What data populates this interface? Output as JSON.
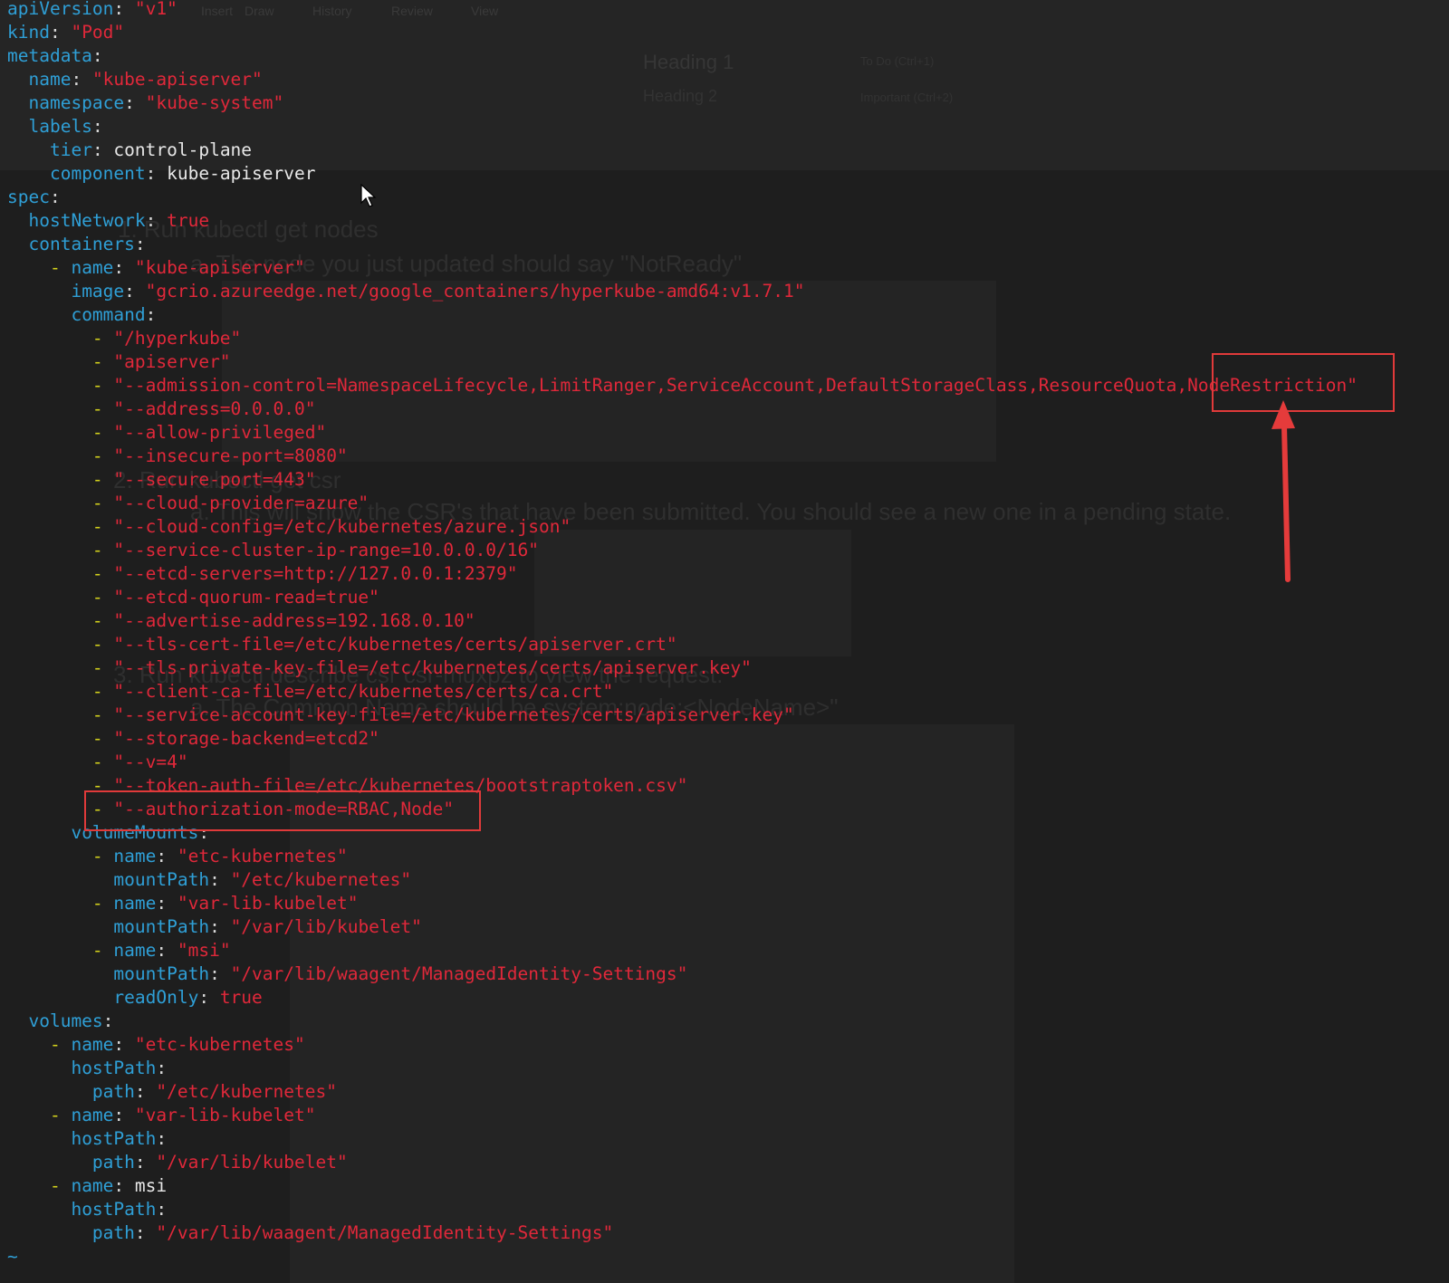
{
  "background_app": {
    "menu": [
      "Insert",
      "Draw",
      "History",
      "Review",
      "View"
    ],
    "heading1": "Heading 1",
    "heading2": "Heading 2",
    "todo_tag": "To Do (Ctrl+1)",
    "important_tag": "Important (Ctrl+2)",
    "notes": [
      "1.   Run kubectl get nodes",
      "a.  The node you just updated should say \"NotReady\"",
      "2.  Run kubectl get csr",
      "a.  This will show the CSR's that have been submitted. You should see a new one in a pending state.",
      "3.  Run kubectl describe csr csr-muxpz to view the request.",
      "a.  The Common Name should be system:node:<NodeName>\""
    ]
  },
  "terminal": {
    "lines": [
      [
        [
          "k",
          "apiVersion"
        ],
        [
          "p",
          ": "
        ],
        [
          "s",
          "\"v1\""
        ]
      ],
      [
        [
          "k",
          "kind"
        ],
        [
          "p",
          ": "
        ],
        [
          "s",
          "\"Pod\""
        ]
      ],
      [
        [
          "k",
          "metadata"
        ],
        [
          "p",
          ":"
        ]
      ],
      [
        [
          "p",
          "  "
        ],
        [
          "k",
          "name"
        ],
        [
          "p",
          ": "
        ],
        [
          "s",
          "\"kube-apiserver\""
        ]
      ],
      [
        [
          "p",
          "  "
        ],
        [
          "k",
          "namespace"
        ],
        [
          "p",
          ": "
        ],
        [
          "s",
          "\"kube-system\""
        ]
      ],
      [
        [
          "p",
          "  "
        ],
        [
          "k",
          "labels"
        ],
        [
          "p",
          ":"
        ]
      ],
      [
        [
          "p",
          "    "
        ],
        [
          "k",
          "tier"
        ],
        [
          "p",
          ": "
        ],
        [
          "v",
          "control-plane"
        ]
      ],
      [
        [
          "p",
          "    "
        ],
        [
          "k",
          "component"
        ],
        [
          "p",
          ": "
        ],
        [
          "v",
          "kube-apiserver"
        ]
      ],
      [
        [
          "k",
          "spec"
        ],
        [
          "p",
          ":"
        ]
      ],
      [
        [
          "p",
          "  "
        ],
        [
          "k",
          "hostNetwork"
        ],
        [
          "p",
          ": "
        ],
        [
          "s",
          "true"
        ]
      ],
      [
        [
          "p",
          "  "
        ],
        [
          "k",
          "containers"
        ],
        [
          "p",
          ":"
        ]
      ],
      [
        [
          "p",
          "    "
        ],
        [
          "d",
          "- "
        ],
        [
          "k",
          "name"
        ],
        [
          "p",
          ": "
        ],
        [
          "s",
          "\"kube-apiserver\""
        ]
      ],
      [
        [
          "p",
          "      "
        ],
        [
          "k",
          "image"
        ],
        [
          "p",
          ": "
        ],
        [
          "s",
          "\"gcrio.azureedge.net/google_containers/hyperkube-amd64:v1.7.1\""
        ]
      ],
      [
        [
          "p",
          "      "
        ],
        [
          "k",
          "command"
        ],
        [
          "p",
          ":"
        ]
      ],
      [
        [
          "p",
          "        "
        ],
        [
          "d",
          "- "
        ],
        [
          "s",
          "\"/hyperkube\""
        ]
      ],
      [
        [
          "p",
          "        "
        ],
        [
          "d",
          "- "
        ],
        [
          "s",
          "\"apiserver\""
        ]
      ],
      [
        [
          "p",
          "        "
        ],
        [
          "d",
          "- "
        ],
        [
          "s",
          "\"--admission-control=NamespaceLifecycle,LimitRanger,ServiceAccount,DefaultStorageClass,ResourceQuota,NodeRestriction\""
        ]
      ],
      [
        [
          "p",
          "        "
        ],
        [
          "d",
          "- "
        ],
        [
          "s",
          "\"--address=0.0.0.0\""
        ]
      ],
      [
        [
          "p",
          "        "
        ],
        [
          "d",
          "- "
        ],
        [
          "s",
          "\"--allow-privileged\""
        ]
      ],
      [
        [
          "p",
          "        "
        ],
        [
          "d",
          "- "
        ],
        [
          "s",
          "\"--insecure-port=8080\""
        ]
      ],
      [
        [
          "p",
          "        "
        ],
        [
          "d",
          "- "
        ],
        [
          "s",
          "\"--secure-port=443\""
        ]
      ],
      [
        [
          "p",
          "        "
        ],
        [
          "d",
          "- "
        ],
        [
          "s",
          "\"--cloud-provider=azure\""
        ]
      ],
      [
        [
          "p",
          "        "
        ],
        [
          "d",
          "- "
        ],
        [
          "s",
          "\"--cloud-config=/etc/kubernetes/azure.json\""
        ]
      ],
      [
        [
          "p",
          "        "
        ],
        [
          "d",
          "- "
        ],
        [
          "s",
          "\"--service-cluster-ip-range=10.0.0.0/16\""
        ]
      ],
      [
        [
          "p",
          "        "
        ],
        [
          "d",
          "- "
        ],
        [
          "s",
          "\"--etcd-servers=http://127.0.0.1:2379\""
        ]
      ],
      [
        [
          "p",
          "        "
        ],
        [
          "d",
          "- "
        ],
        [
          "s",
          "\"--etcd-quorum-read=true\""
        ]
      ],
      [
        [
          "p",
          "        "
        ],
        [
          "d",
          "- "
        ],
        [
          "s",
          "\"--advertise-address=192.168.0.10\""
        ]
      ],
      [
        [
          "p",
          "        "
        ],
        [
          "d",
          "- "
        ],
        [
          "s",
          "\"--tls-cert-file=/etc/kubernetes/certs/apiserver.crt\""
        ]
      ],
      [
        [
          "p",
          "        "
        ],
        [
          "d",
          "- "
        ],
        [
          "s",
          "\"--tls-private-key-file=/etc/kubernetes/certs/apiserver.key\""
        ]
      ],
      [
        [
          "p",
          "        "
        ],
        [
          "d",
          "- "
        ],
        [
          "s",
          "\"--client-ca-file=/etc/kubernetes/certs/ca.crt\""
        ]
      ],
      [
        [
          "p",
          "        "
        ],
        [
          "d",
          "- "
        ],
        [
          "s",
          "\"--service-account-key-file=/etc/kubernetes/certs/apiserver.key\""
        ]
      ],
      [
        [
          "p",
          "        "
        ],
        [
          "d",
          "- "
        ],
        [
          "s",
          "\"--storage-backend=etcd2\""
        ]
      ],
      [
        [
          "p",
          "        "
        ],
        [
          "d",
          "- "
        ],
        [
          "s",
          "\"--v=4\""
        ]
      ],
      [
        [
          "p",
          "        "
        ],
        [
          "d",
          "- "
        ],
        [
          "s",
          "\"--token-auth-file=/etc/kubernetes/bootstraptoken.csv\""
        ]
      ],
      [
        [
          "p",
          "        "
        ],
        [
          "d",
          "- "
        ],
        [
          "s",
          "\"--authorization-mode=RBAC,Node\""
        ]
      ],
      [
        [
          "p",
          "      "
        ],
        [
          "k",
          "volumeMounts"
        ],
        [
          "p",
          ":"
        ]
      ],
      [
        [
          "p",
          "        "
        ],
        [
          "d",
          "- "
        ],
        [
          "k",
          "name"
        ],
        [
          "p",
          ": "
        ],
        [
          "s",
          "\"etc-kubernetes\""
        ]
      ],
      [
        [
          "p",
          "          "
        ],
        [
          "k",
          "mountPath"
        ],
        [
          "p",
          ": "
        ],
        [
          "s",
          "\"/etc/kubernetes\""
        ]
      ],
      [
        [
          "p",
          "        "
        ],
        [
          "d",
          "- "
        ],
        [
          "k",
          "name"
        ],
        [
          "p",
          ": "
        ],
        [
          "s",
          "\"var-lib-kubelet\""
        ]
      ],
      [
        [
          "p",
          "          "
        ],
        [
          "k",
          "mountPath"
        ],
        [
          "p",
          ": "
        ],
        [
          "s",
          "\"/var/lib/kubelet\""
        ]
      ],
      [
        [
          "p",
          "        "
        ],
        [
          "d",
          "- "
        ],
        [
          "k",
          "name"
        ],
        [
          "p",
          ": "
        ],
        [
          "s",
          "\"msi\""
        ]
      ],
      [
        [
          "p",
          "          "
        ],
        [
          "k",
          "mountPath"
        ],
        [
          "p",
          ": "
        ],
        [
          "s",
          "\"/var/lib/waagent/ManagedIdentity-Settings\""
        ]
      ],
      [
        [
          "p",
          "          "
        ],
        [
          "k",
          "readOnly"
        ],
        [
          "p",
          ": "
        ],
        [
          "s",
          "true"
        ]
      ],
      [
        [
          "p",
          "  "
        ],
        [
          "k",
          "volumes"
        ],
        [
          "p",
          ":"
        ]
      ],
      [
        [
          "p",
          "    "
        ],
        [
          "d",
          "- "
        ],
        [
          "k",
          "name"
        ],
        [
          "p",
          ": "
        ],
        [
          "s",
          "\"etc-kubernetes\""
        ]
      ],
      [
        [
          "p",
          "      "
        ],
        [
          "k",
          "hostPath"
        ],
        [
          "p",
          ":"
        ]
      ],
      [
        [
          "p",
          "        "
        ],
        [
          "k",
          "path"
        ],
        [
          "p",
          ": "
        ],
        [
          "s",
          "\"/etc/kubernetes\""
        ]
      ],
      [
        [
          "p",
          "    "
        ],
        [
          "d",
          "- "
        ],
        [
          "k",
          "name"
        ],
        [
          "p",
          ": "
        ],
        [
          "s",
          "\"var-lib-kubelet\""
        ]
      ],
      [
        [
          "p",
          "      "
        ],
        [
          "k",
          "hostPath"
        ],
        [
          "p",
          ":"
        ]
      ],
      [
        [
          "p",
          "        "
        ],
        [
          "k",
          "path"
        ],
        [
          "p",
          ": "
        ],
        [
          "s",
          "\"/var/lib/kubelet\""
        ]
      ],
      [
        [
          "p",
          "    "
        ],
        [
          "d",
          "- "
        ],
        [
          "k",
          "name"
        ],
        [
          "p",
          ": "
        ],
        [
          "v",
          "msi"
        ]
      ],
      [
        [
          "p",
          "      "
        ],
        [
          "k",
          "hostPath"
        ],
        [
          "p",
          ":"
        ]
      ],
      [
        [
          "p",
          "        "
        ],
        [
          "k",
          "path"
        ],
        [
          "p",
          ": "
        ],
        [
          "s",
          "\"/var/lib/waagent/ManagedIdentity-Settings\""
        ]
      ],
      [
        [
          "t",
          "~"
        ]
      ]
    ]
  },
  "annotations": {
    "box_color": "#e03a3a",
    "highlight_1": "NodeRestriction",
    "highlight_2": "- \"--authorization-mode=RBAC,Node\""
  },
  "colors": {
    "key": "#2f9fd6",
    "string": "#e0283a",
    "dash": "#d4d21c",
    "plain": "#e8e8e8",
    "background": "#1e1e1e"
  }
}
